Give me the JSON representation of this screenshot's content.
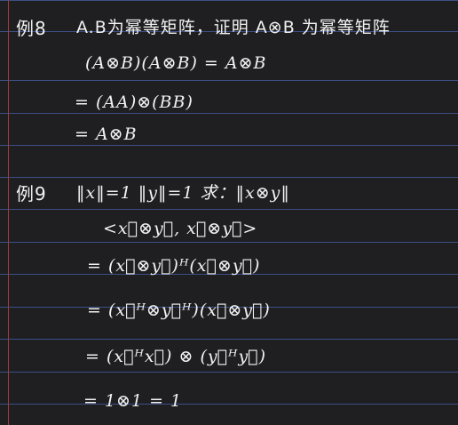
{
  "example8": {
    "label": "例8",
    "statement": "A.B为幂等矩阵，证明 A⊗B 为幂等矩阵",
    "steps": [
      "(A⊗B)(A⊗B) = A⊗B",
      "= (AA)⊗(BB)",
      "= A⊗B"
    ]
  },
  "example9": {
    "label": "例9",
    "statement": "‖x‖=1  ‖y‖=1  求：‖x⊗y‖",
    "steps": [
      "<x⃗⊗y⃗, x⃗⊗y⃗>",
      "= (x⃗⊗y⃗)ᴴ(x⃗⊗y⃗)",
      "= (x⃗ᴴ⊗y⃗ᴴ)(x⃗⊗y⃗)",
      "= (x⃗ᴴx⃗) ⊗ (y⃗ᴴy⃗)",
      "= 1⊗1 = 1"
    ]
  }
}
